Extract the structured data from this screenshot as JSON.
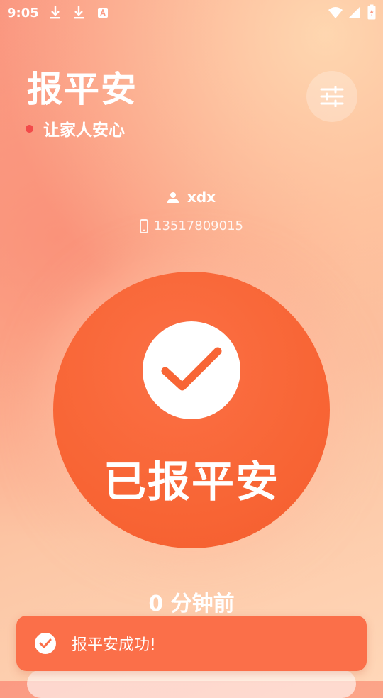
{
  "status_bar": {
    "time": "9:05",
    "icons": [
      "download-icon",
      "download-icon",
      "font-icon",
      "wifi-icon",
      "signal-icon",
      "battery-icon"
    ]
  },
  "header": {
    "title": "报平安",
    "subtitle": "让家人安心",
    "settings_icon": "sliders-icon"
  },
  "user": {
    "name": "xdx",
    "phone": "13517809015"
  },
  "main_button": {
    "label": "已报平安"
  },
  "last_report": {
    "text": "0 分钟前"
  },
  "toast": {
    "text": "报平安成功!"
  },
  "colors": {
    "accent": "#f86535",
    "toast_bg": "#fb6f49",
    "dot": "#f34a4a",
    "bg_start": "#fb9a83",
    "bg_end": "#ffd7b8"
  }
}
